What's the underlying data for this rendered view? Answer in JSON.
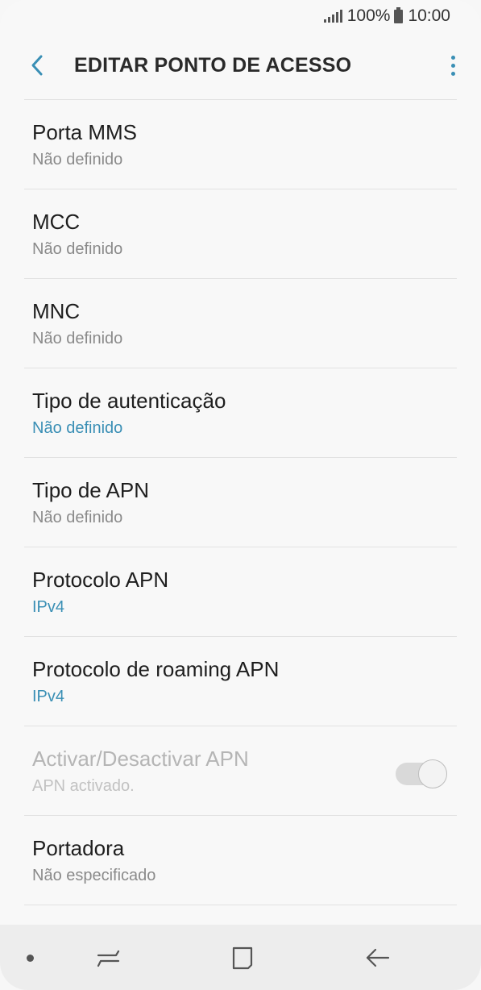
{
  "status_bar": {
    "battery": "100%",
    "time": "10:00"
  },
  "app_bar": {
    "title": "EDITAR PONTO DE ACESSO",
    "back_icon": "chevron-left-icon",
    "more_icon": "more-vertical-icon"
  },
  "settings": [
    {
      "label": "Porta MMS",
      "value": "Não definido",
      "accent": false
    },
    {
      "label": "MCC",
      "value": "Não definido",
      "accent": false
    },
    {
      "label": "MNC",
      "value": "Não definido",
      "accent": false
    },
    {
      "label": "Tipo de autenticação",
      "value": "Não definido",
      "accent": true
    },
    {
      "label": "Tipo de APN",
      "value": "Não definido",
      "accent": false
    },
    {
      "label": "Protocolo APN",
      "value": "IPv4",
      "accent": true
    },
    {
      "label": "Protocolo de roaming APN",
      "value": "IPv4",
      "accent": true
    },
    {
      "label": "Activar/Desactivar APN",
      "value": "APN activado.",
      "disabled": true,
      "toggle_on": true
    },
    {
      "label": "Portadora",
      "value": "Não especificado",
      "accent": false
    }
  ],
  "nav_bar": {
    "recents_icon": "recents-icon",
    "home_icon": "home-icon",
    "back_icon": "back-arrow-icon"
  },
  "colors": {
    "accent": "#3a8fb5",
    "background": "#f8f8f8",
    "nav_background": "#ededed"
  }
}
